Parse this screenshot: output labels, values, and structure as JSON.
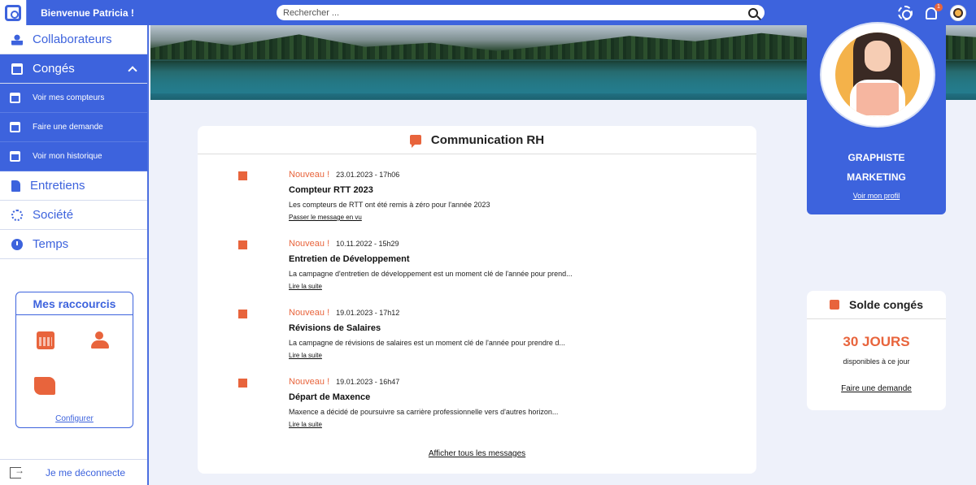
{
  "header": {
    "welcome": "Bienvenue Patricia !",
    "search_placeholder": "Rechercher ...",
    "notification_count": "1"
  },
  "sidebar": {
    "items": [
      {
        "label": "Collaborateurs"
      },
      {
        "label": "Congés"
      },
      {
        "label": "Entretiens"
      },
      {
        "label": "Société"
      },
      {
        "label": "Temps"
      }
    ],
    "conges_sub": [
      {
        "label": "Voir mes compteurs"
      },
      {
        "label": "Faire une demande"
      },
      {
        "label": "Voir mon historique"
      }
    ],
    "shortcuts_title": "Mes raccourcis",
    "configure_label": "Configurer",
    "logout_label": "Je me déconnecte"
  },
  "profile": {
    "role_line1": "GRAPHISTE",
    "role_line2": "MARKETING",
    "link": "Voir mon profil"
  },
  "communication": {
    "title": "Communication RH",
    "messages": [
      {
        "tag": "Nouveau !",
        "date": "23.01.2023 - 17h06",
        "title": "Compteur RTT 2023",
        "body": "Les compteurs de RTT ont été remis à zéro pour l'année 2023",
        "link": "Passer le message en vu"
      },
      {
        "tag": "Nouveau !",
        "date": "10.11.2022 - 15h29",
        "title": "Entretien de Développement",
        "body": "La campagne d'entretien de développement est un moment clé de l'année pour prend...",
        "link": "Lire la suite"
      },
      {
        "tag": "Nouveau !",
        "date": "19.01.2023 - 17h12",
        "title": "Révisions de Salaires",
        "body": "La campagne de révisions de salaires est un moment clé de l'année pour prendre d...",
        "link": "Lire la suite"
      },
      {
        "tag": "Nouveau !",
        "date": "19.01.2023 - 16h47",
        "title": "Départ de Maxence",
        "body": "Maxence a décidé de poursuivre sa carrière professionnelle vers d'autres horizon...",
        "link": "Lire la suite"
      }
    ],
    "all_link": "Afficher tous les messages"
  },
  "solde": {
    "title": "Solde congés",
    "days": "30 JOURS",
    "subtitle": "disponibles à ce jour",
    "link": "Faire une demande"
  },
  "colors": {
    "primary": "#3d63dd",
    "accent": "#e8643c"
  }
}
